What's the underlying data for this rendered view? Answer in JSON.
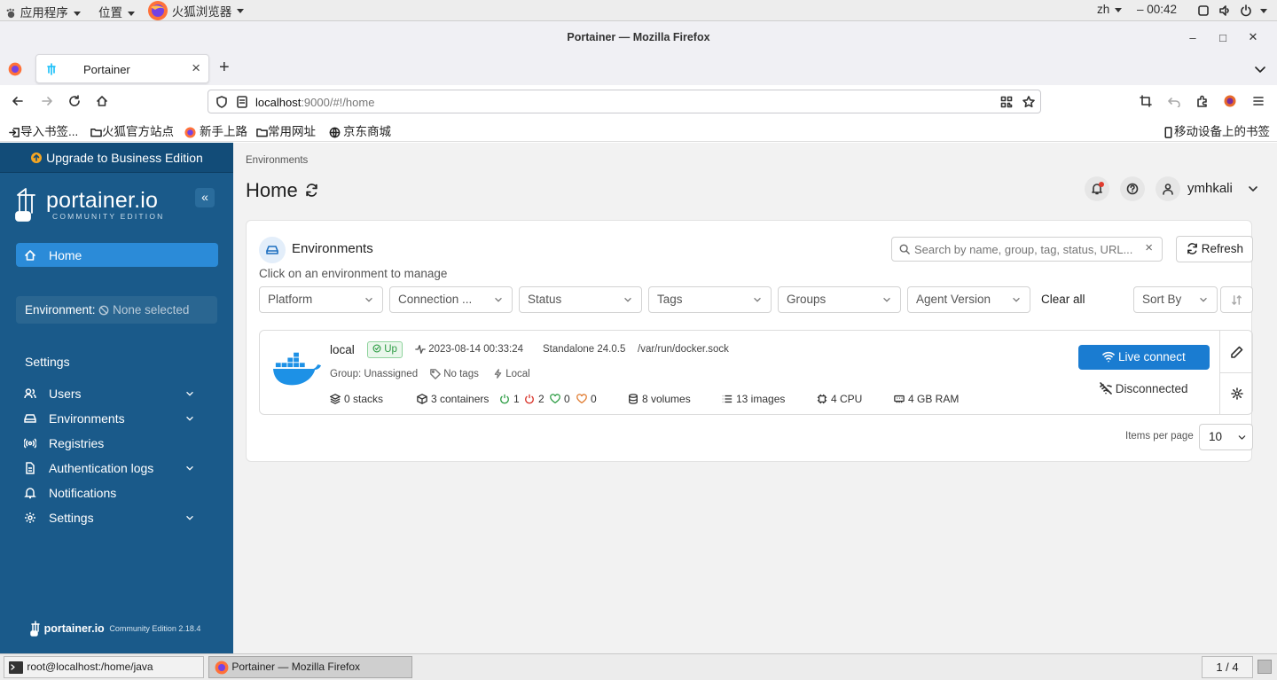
{
  "desktop": {
    "apps_menu": "应用程序",
    "places_menu": "位置",
    "browser_menu": "火狐浏览器",
    "lang": "zh",
    "clock": "00:42"
  },
  "window": {
    "title": "Portainer — Mozilla Firefox",
    "minimize": "–",
    "maximize": "□",
    "close": "✕"
  },
  "tab": {
    "label": "Portainer",
    "close": "×",
    "new_tab": "+"
  },
  "url": {
    "host": "localhost",
    "rest": ":9000/#!/home"
  },
  "bookmarks": [
    "导入书签...",
    "火狐官方站点",
    "新手上路",
    "常用网址",
    "京东商城"
  ],
  "mobile_bookmarks": "移动设备上的书签",
  "sidebar": {
    "upgrade": "Upgrade to Business Edition",
    "logo_text": "portainer.io",
    "logo_sub": "COMMUNITY EDITION",
    "home": "Home",
    "env_label": "Environment:",
    "env_value": "None selected",
    "settings_heading": "Settings",
    "items": [
      {
        "label": "Users",
        "icon": "users-icon",
        "chevron": true
      },
      {
        "label": "Environments",
        "icon": "environments-icon",
        "chevron": true
      },
      {
        "label": "Registries",
        "icon": "registries-icon",
        "chevron": false
      },
      {
        "label": "Authentication logs",
        "icon": "auth-logs-icon",
        "chevron": true
      },
      {
        "label": "Notifications",
        "icon": "bell-icon",
        "chevron": false
      },
      {
        "label": "Settings",
        "icon": "gear-icon",
        "chevron": true
      }
    ],
    "footer_logo": "portainer.io",
    "footer_version": "Community Edition 2.18.4"
  },
  "main": {
    "breadcrumb": "Environments",
    "title": "Home",
    "username": "ymhkali",
    "panel_title": "Environments",
    "search_placeholder": "Search by name, group, tag, status, URL...",
    "refresh_button": "Refresh",
    "hint": "Click on an environment to manage",
    "filters": [
      "Platform",
      "Connection ...",
      "Status",
      "Tags",
      "Groups",
      "Agent Version"
    ],
    "clear_all": "Clear all",
    "sort_by": "Sort By",
    "items_per_page_label": "Items per page",
    "items_per_page": "10"
  },
  "environment": {
    "name": "local",
    "status": "Up",
    "timestamp": "2023-08-14 00:33:24",
    "type": "Standalone 24.0.5",
    "url": "/var/run/docker.sock",
    "group": "Group: Unassigned",
    "tags": "No tags",
    "locality": "Local",
    "stacks": "0 stacks",
    "containers": "3 containers",
    "running": "1",
    "stopped": "2",
    "healthy": "0",
    "unhealthy": "0",
    "volumes": "8 volumes",
    "images": "13 images",
    "cpu": "4 CPU",
    "ram": "4 GB RAM",
    "live_connect": "Live connect",
    "disconnected": "Disconnected"
  },
  "taskbar": {
    "terminal": "root@localhost:/home/java",
    "firefox": "Portainer — Mozilla Firefox",
    "workspace": "1 / 4"
  },
  "colors": {
    "sidebar": "#1a5a8a",
    "accent": "#1d6fc0",
    "live_connect": "#1a7cd1",
    "up_badge": "#2e9d45"
  }
}
